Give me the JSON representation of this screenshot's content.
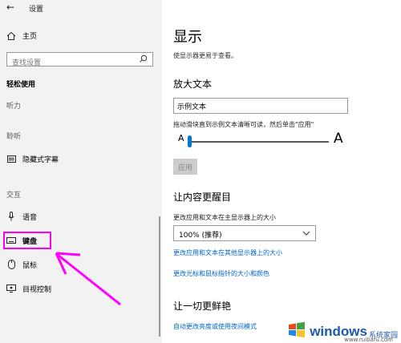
{
  "window": {
    "title": "设置",
    "back_icon": "arrow-left-icon",
    "controls": [
      "—",
      "☐",
      "✕"
    ]
  },
  "sidebar": {
    "home_label": "主页",
    "search_placeholder": "查找设置",
    "section_title": "轻松使用",
    "groups": {
      "vision": "听力",
      "hearing": "聆听",
      "interaction": "交互"
    },
    "items": [
      {
        "label": "隐藏式字幕",
        "icon": "closed-captions-icon"
      },
      {
        "label": "语音",
        "icon": "microphone-icon"
      },
      {
        "label": "键盘",
        "icon": "keyboard-icon",
        "highlighted": true
      },
      {
        "label": "鼠标",
        "icon": "mouse-icon"
      },
      {
        "label": "目视控制",
        "icon": "eye-control-icon"
      }
    ],
    "annotation_color": "#ff00ff"
  },
  "main": {
    "title": "显示",
    "description": "使显示器更易于查看。",
    "magnify_text": {
      "heading": "放大文本",
      "sample": "示例文本",
      "hint": "拖动滑块直到示例文本清晰可读，然后单击\"应用\"",
      "slider_min_label": "A",
      "slider_max_label": "A",
      "slider_value": 0,
      "apply": "应用"
    },
    "brighter": {
      "heading": "让内容更醒目",
      "size_label": "更改应用和文本在主显示器上的大小",
      "size_value": "100% (推荐)",
      "link1": "更改应用和文本在其他显示器上的大小",
      "link2": "更改光标和鼠标指针的大小和颜色"
    },
    "vivid": {
      "heading": "让一切更鲜艳",
      "link": "自动更改亮度或使用夜间模式"
    }
  },
  "watermark": {
    "brand": "windows",
    "brand_suffix": "系统家园",
    "url": "www.ruibafu.com"
  },
  "colors": {
    "accent": "#0078d7",
    "link": "#0066cc",
    "sidebar_bg": "#f2f2f2"
  }
}
